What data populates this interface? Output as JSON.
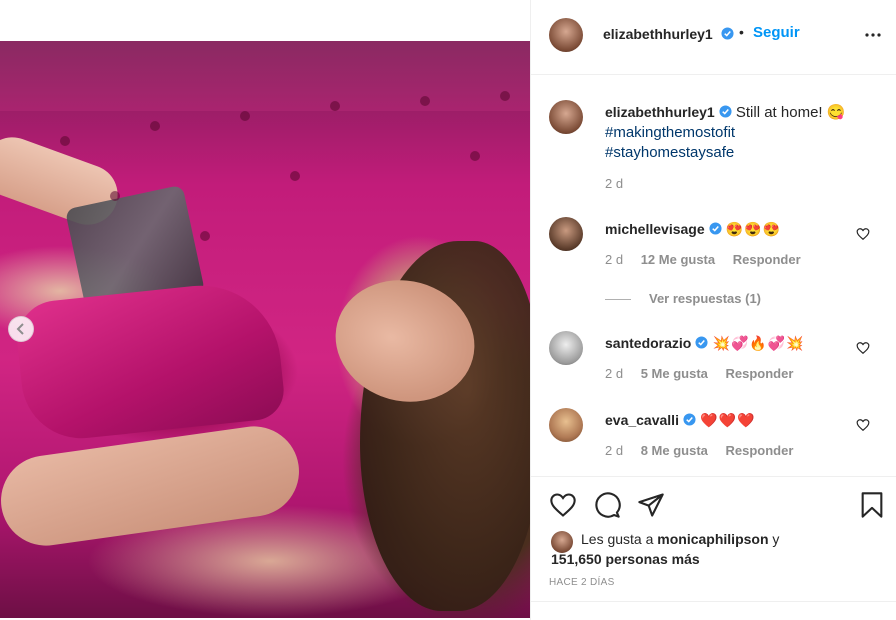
{
  "post": {
    "author": "elizabethhurley1",
    "follow_label": "Seguir",
    "caption_text": "Still at home! 😋",
    "hashtags": [
      "#makingthemostofit",
      "#stayhomestaysafe"
    ],
    "caption_time": "2 d"
  },
  "comments": [
    {
      "user": "michellevisage",
      "verified": true,
      "text": "😍😍😍",
      "time": "2 d",
      "likes": "12 Me gusta",
      "reply_label": "Responder",
      "view_replies": "Ver respuestas (1)"
    },
    {
      "user": "santedorazio",
      "verified": true,
      "text": "💥💞🔥💞💥",
      "time": "2 d",
      "likes": "5 Me gusta",
      "reply_label": "Responder"
    },
    {
      "user": "eva_cavalli",
      "verified": true,
      "text": "❤️❤️❤️",
      "time": "2 d",
      "likes": "8 Me gusta",
      "reply_label": "Responder"
    }
  ],
  "likes_summary": {
    "prefix": "Les gusta a",
    "user": "monicaphilipson",
    "connector": "y",
    "count": "151,650 personas más"
  },
  "timestamp": "HACE 2 DÍAS",
  "icons": {
    "verified": "verified-badge-icon",
    "more": "more-options-icon",
    "like": "heart-icon",
    "comment": "comment-icon",
    "share": "paper-plane-icon",
    "save": "bookmark-icon",
    "prev": "chevron-left-icon"
  },
  "colors": {
    "accent": "#0095f6",
    "hashtag": "#00376b",
    "muted": "#8e8e8e",
    "text": "#262626"
  }
}
